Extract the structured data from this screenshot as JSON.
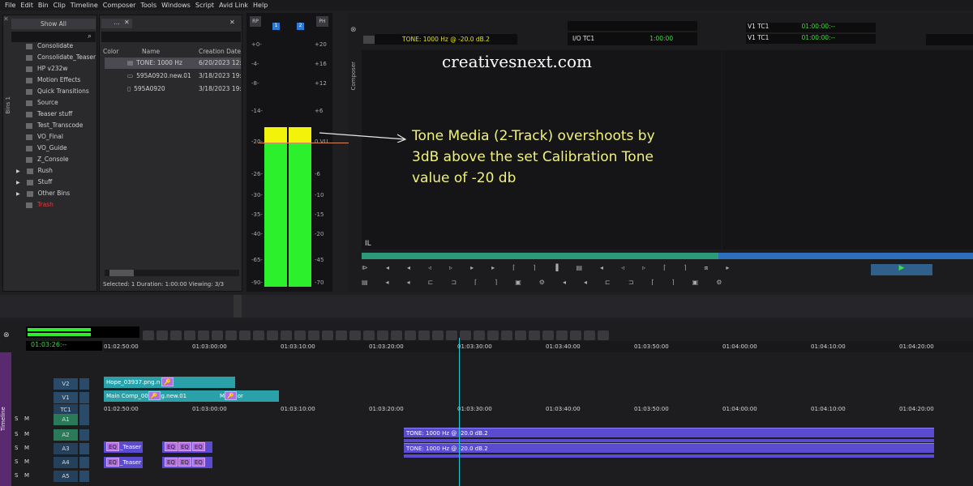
{
  "menu": [
    "File",
    "Edit",
    "Bin",
    "Clip",
    "Timeline",
    "Composer",
    "Tools",
    "Windows",
    "Script",
    "Avid Link",
    "Help"
  ],
  "bins_panel": {
    "filter": "Show All",
    "side_tab": "Bins 1",
    "items": [
      {
        "label": "Consolidate",
        "type": "bin"
      },
      {
        "label": "Consolidate_Teaser",
        "type": "bin"
      },
      {
        "label": "HP v232w",
        "type": "bin"
      },
      {
        "label": "Motion Effects",
        "type": "bin"
      },
      {
        "label": "Quick Transitions",
        "type": "bin"
      },
      {
        "label": "Source",
        "type": "bin"
      },
      {
        "label": "Teaser stuff",
        "type": "bin"
      },
      {
        "label": "Test_Transcode",
        "type": "bin"
      },
      {
        "label": "VO_Final",
        "type": "bin"
      },
      {
        "label": "VO_Guide",
        "type": "bin"
      },
      {
        "label": "Z_Console",
        "type": "bin"
      },
      {
        "label": "Rush",
        "type": "folder"
      },
      {
        "label": "Stuff",
        "type": "folder"
      },
      {
        "label": "Other Bins",
        "type": "folder"
      },
      {
        "label": "Trash",
        "type": "trash"
      }
    ]
  },
  "bin_table": {
    "tab_label": "...",
    "columns": [
      "Color",
      "Name",
      "Creation Date"
    ],
    "rows": [
      {
        "name": "TONE: 1000 Hz",
        "date": "6/20/2023 12:4"
      },
      {
        "name": "595A0920.new.01",
        "date": "3/18/2023 19:4"
      },
      {
        "name": "595A0920",
        "date": "3/18/2023 19:0"
      }
    ],
    "status": "Selected: 1  Duration: 1:00:00  Viewing: 3/3"
  },
  "meters": {
    "buttons": [
      "RP",
      "1",
      "2",
      "PH"
    ],
    "left_scale": [
      "+0-",
      "-4-",
      "-8-",
      "-14-",
      "-20-",
      "-26-",
      "-30-",
      "-35-",
      "-40-",
      "-65-",
      "-90-"
    ],
    "right_scale": [
      "+20",
      "+16",
      "+12",
      "+6",
      "0 VU",
      "-6",
      "-10",
      "-15",
      "-20",
      "-45",
      "-70"
    ],
    "level_ch1": -17,
    "level_ch2": -17,
    "reference": -20
  },
  "composer": {
    "side_tab": "Composer",
    "source_name": "TONE: 1000 Hz @ -20.0 dB.2",
    "io_label": "I/O  TC1",
    "io_value": "1:00:00",
    "v1_a_label": "V1  TC1",
    "v1_a_value": "01:00:00:--",
    "v1_b_label": "V1  TC1",
    "v1_b_value": "01:00:00:--",
    "mark": "IL"
  },
  "watermark": "creativesnext.com",
  "annotation": "Tone Media (2-Track) overshoots by 3dB above the set Calibration Tone value of -20 db",
  "annotation_lines": [
    "Tone Media (2-Track) overshoots by",
    "3dB above the set Calibration Tone",
    "value of -20 db"
  ],
  "timeline": {
    "side_tab": "Timeline",
    "timecode": "01:03:26:--",
    "ruler_labels": [
      "01:02:50:00",
      "01:03:00:00",
      "01:03:10:00",
      "01:03:20:00",
      "01:03:30:00",
      "01:03:40:00",
      "01:03:50:00",
      "01:04:00:00",
      "01:04:10:00",
      "01:04:20:00"
    ],
    "tracks": [
      "V2",
      "V1",
      "TC1",
      "A1",
      "A2",
      "A3",
      "A4",
      "A5"
    ],
    "clips": {
      "v2_name": "Hope_03937.png.n",
      "v1_name": "Main Comp_00",
      "v1_name2": "g.new.01",
      "v1_short": "M",
      "v1_short2": "or",
      "a3_name": "_Teaser",
      "a4_name": "_Teaser",
      "tone_a2": "TONE: 1000 Hz @ -20.0 dB.2",
      "tone_a3": "TONE: 1000 Hz @ -20.0 dB.2",
      "eq": "EQ"
    }
  }
}
